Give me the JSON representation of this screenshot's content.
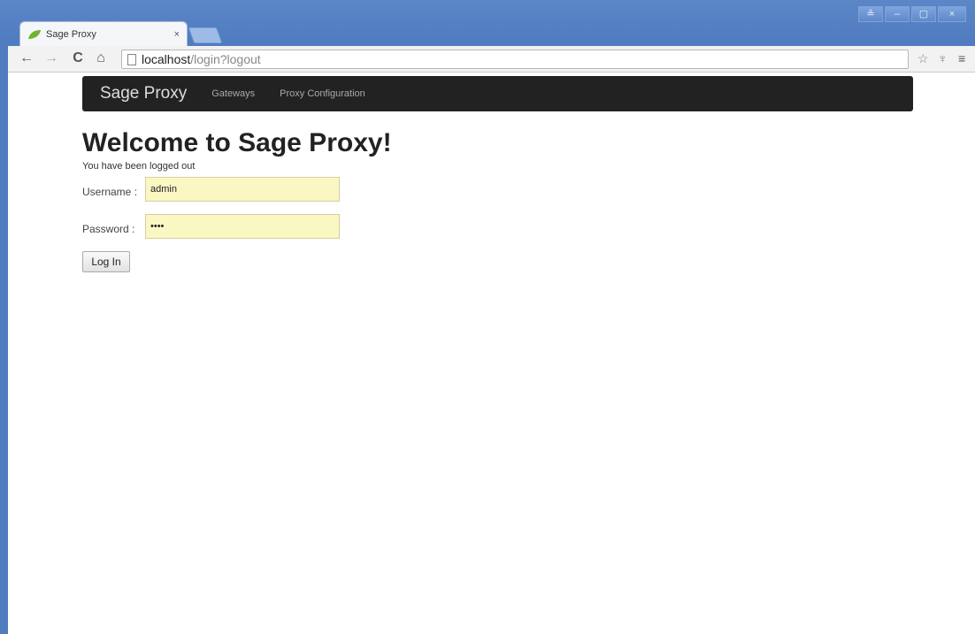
{
  "browser": {
    "tab_title": "Sage Proxy",
    "tab_close": "×",
    "url_host": "localhost",
    "url_path": "/login?logout",
    "controls": {
      "profile": "≗",
      "minimize": "–",
      "maximize": "▢",
      "close": "×"
    },
    "nav": {
      "back": "←",
      "forward": "→",
      "reload": "C",
      "home": "⌂"
    },
    "right_icons": {
      "star": "☆",
      "wrench": "♆",
      "menu": "≡"
    }
  },
  "navbar": {
    "brand": "Sage Proxy",
    "links": [
      "Gateways",
      "Proxy Configuration"
    ]
  },
  "page": {
    "heading": "Welcome to Sage Proxy!",
    "message": "You have been logged out",
    "username_label": "Username :",
    "username_value": "admin",
    "password_label": "Password :",
    "password_value": "••••",
    "login_button": "Log In"
  },
  "colors": {
    "titlebar": "#5b87c9",
    "navbar": "#222222",
    "input_autofill": "#fbf7c3",
    "favicon_green": "#6fb32e"
  }
}
